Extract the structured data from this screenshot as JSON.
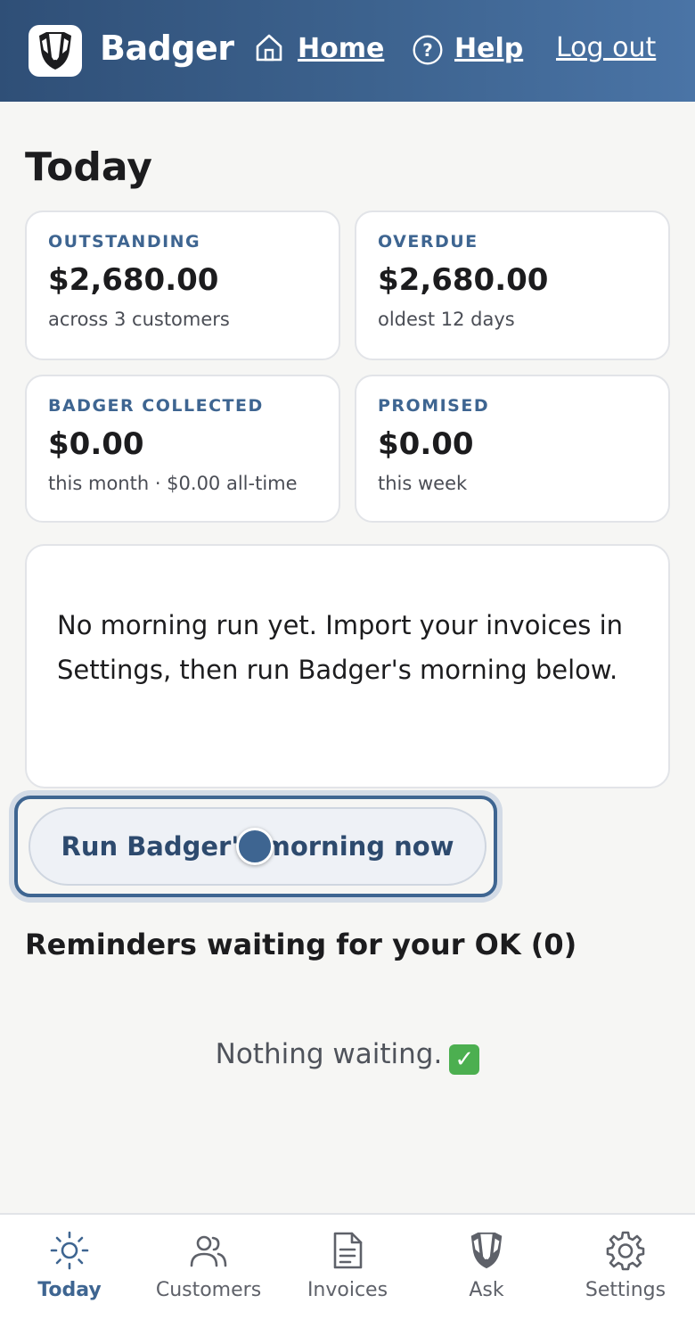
{
  "header": {
    "brand": "Badger",
    "nav": {
      "home": "Home",
      "help": "Help",
      "logout": "Log out"
    },
    "colors": {
      "gradient_start": "#2f4f77",
      "gradient_end": "#4a74a6"
    }
  },
  "page": {
    "title": "Today"
  },
  "stats": {
    "outstanding": {
      "label": "OUTSTANDING",
      "value": "$2,680.00",
      "sub": "across 3 customers"
    },
    "overdue": {
      "label": "OVERDUE",
      "value": "$2,680.00",
      "sub": "oldest 12 days"
    },
    "collected": {
      "label": "BADGER COLLECTED",
      "value": "$0.00",
      "sub": "this month · $0.00 all-time"
    },
    "promised": {
      "label": "PROMISED",
      "value": "$0.00",
      "sub": "this week"
    }
  },
  "info": {
    "message": "No morning run yet. Import your invoices in Settings, then run Badger's morning below."
  },
  "actions": {
    "run_label": "Run Badger's morning now"
  },
  "reminders": {
    "heading": "Reminders waiting for your OK (0)",
    "empty": "Nothing waiting.",
    "empty_icon": "check-mark-icon"
  },
  "bottom_nav": {
    "tabs": [
      {
        "label": "Today",
        "icon": "sun-icon",
        "active": true
      },
      {
        "label": "Customers",
        "icon": "users-icon",
        "active": false
      },
      {
        "label": "Invoices",
        "icon": "document-icon",
        "active": false
      },
      {
        "label": "Ask",
        "icon": "badger-icon",
        "active": false
      },
      {
        "label": "Settings",
        "icon": "gear-icon",
        "active": false
      }
    ]
  },
  "colors": {
    "accent": "#3e6591",
    "background": "#f6f6f4",
    "card_border": "#e2e4e8"
  }
}
